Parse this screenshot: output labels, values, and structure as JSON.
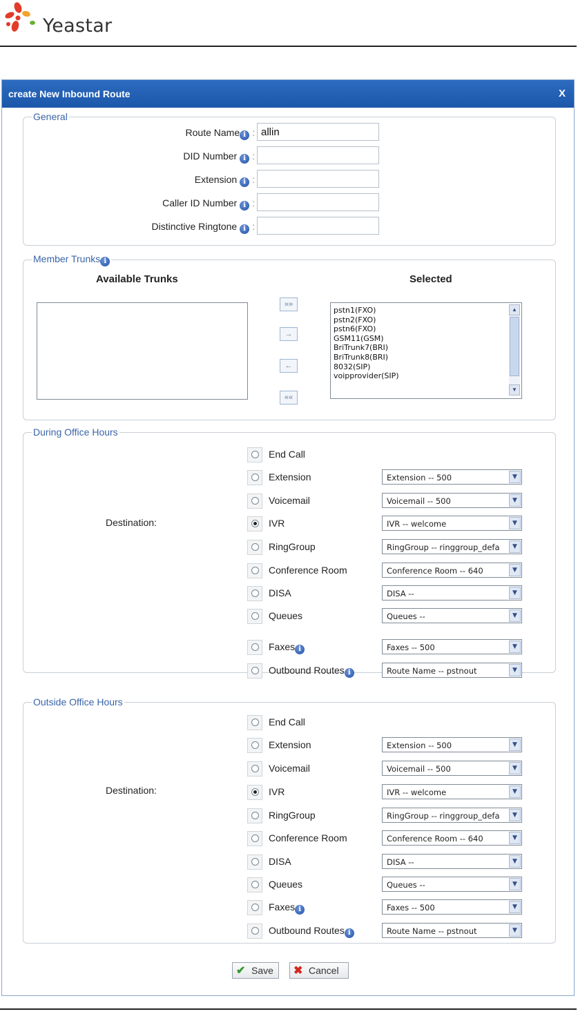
{
  "brand": {
    "name": "Yeastar"
  },
  "dialog": {
    "title": "create New Inbound Route",
    "close_label": "X"
  },
  "general": {
    "legend": "General",
    "fields": [
      {
        "label": "Route Name",
        "sep": ":",
        "value": "allin"
      },
      {
        "label": "DID Number ",
        "sep": ":",
        "value": ""
      },
      {
        "label": "Extension ",
        "sep": ":",
        "value": ""
      },
      {
        "label": "Caller ID Number ",
        "sep": ":",
        "value": ""
      },
      {
        "label": "Distinctive Ringtone ",
        "sep": ":",
        "value": ""
      }
    ]
  },
  "trunks": {
    "legend": "Member Trunks",
    "available_header": "Available Trunks",
    "selected_header": "Selected",
    "available": [],
    "selected": [
      "pstn1(FXO)",
      "pstn2(FXO)",
      "pstn6(FXO)",
      "GSM11(GSM)",
      "BriTrunk7(BRI)",
      "BriTrunk8(BRI)",
      "8032(SIP)",
      "voipprovider(SIP)"
    ],
    "buttons": {
      "add_all": "»»",
      "add": "→",
      "remove": "←",
      "remove_all": "««"
    }
  },
  "destination_label": "Destination:",
  "office_hours": {
    "legend": "During Office Hours",
    "options": [
      {
        "label": "End Call",
        "info": false,
        "checked": false,
        "select": null
      },
      {
        "label": "Extension",
        "info": false,
        "checked": false,
        "select": "Extension -- 500"
      },
      {
        "label": "Voicemail",
        "info": false,
        "checked": false,
        "select": "Voicemail -- 500"
      },
      {
        "label": "IVR",
        "info": false,
        "checked": true,
        "select": "IVR -- welcome"
      },
      {
        "label": "RingGroup",
        "info": false,
        "checked": false,
        "select": "RingGroup -- ringgroup_defa"
      },
      {
        "label": "Conference Room",
        "info": false,
        "checked": false,
        "select": "Conference Room -- 640"
      },
      {
        "label": "DISA",
        "info": false,
        "checked": false,
        "select": "DISA --"
      },
      {
        "label": "Queues",
        "info": false,
        "checked": false,
        "select": "Queues --"
      },
      {
        "label": "Faxes",
        "info": true,
        "checked": false,
        "select": "Faxes -- 500"
      },
      {
        "label": "Outbound Routes",
        "info": true,
        "checked": false,
        "select": "Route Name -- pstnout"
      }
    ]
  },
  "outside_hours": {
    "legend": "Outside Office Hours",
    "options": [
      {
        "label": "End Call",
        "info": false,
        "checked": false,
        "select": null
      },
      {
        "label": "Extension",
        "info": false,
        "checked": false,
        "select": "Extension -- 500"
      },
      {
        "label": "Voicemail",
        "info": false,
        "checked": false,
        "select": "Voicemail -- 500"
      },
      {
        "label": "IVR",
        "info": false,
        "checked": true,
        "select": "IVR -- welcome"
      },
      {
        "label": "RingGroup",
        "info": false,
        "checked": false,
        "select": "RingGroup -- ringgroup_defa"
      },
      {
        "label": "Conference Room",
        "info": false,
        "checked": false,
        "select": "Conference Room -- 640"
      },
      {
        "label": "DISA",
        "info": false,
        "checked": false,
        "select": "DISA --"
      },
      {
        "label": "Queues",
        "info": false,
        "checked": false,
        "select": "Queues --"
      },
      {
        "label": "Faxes",
        "info": true,
        "checked": false,
        "select": "Faxes -- 500"
      },
      {
        "label": "Outbound Routes",
        "info": true,
        "checked": false,
        "select": "Route Name -- pstnout"
      }
    ]
  },
  "actions": {
    "save": "Save",
    "cancel": "Cancel"
  },
  "icons": {
    "info": "info-icon",
    "save": "check-icon",
    "cancel": "x-icon",
    "dropdown": "chevron-down-icon"
  }
}
